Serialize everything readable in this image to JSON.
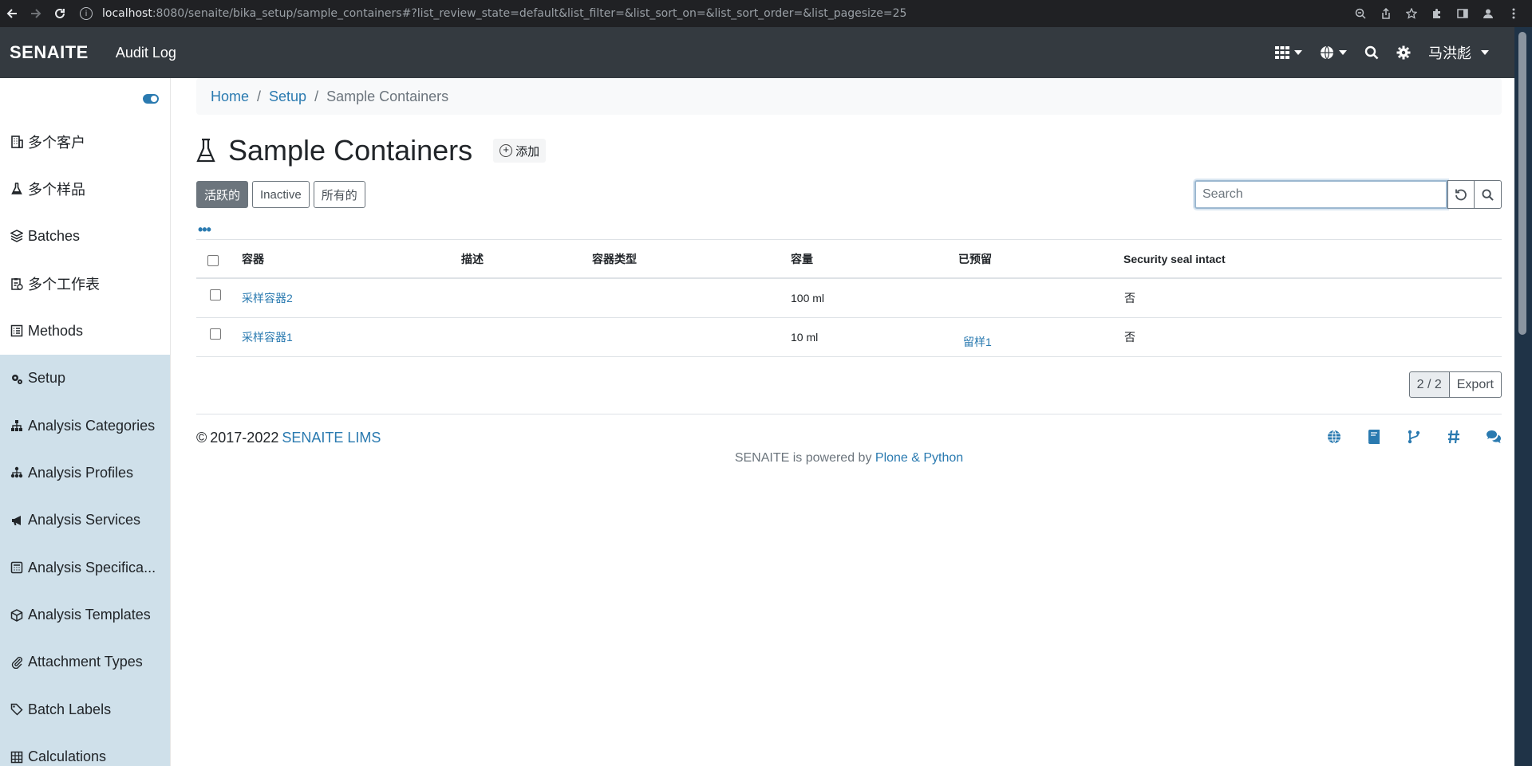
{
  "browser": {
    "url_host": "localhost",
    "url_rest": ":8080/senaite/bika_setup/sample_containers#?list_review_state=default&list_filter=&list_sort_on=&list_sort_order=&list_pagesize=25"
  },
  "navbar": {
    "brand": "SENAITE",
    "audit_log": "Audit Log",
    "user": "马洪彪"
  },
  "sidebar": {
    "items": [
      {
        "label": "多个客户",
        "icon": "clients-icon"
      },
      {
        "label": "多个样品",
        "icon": "flask-icon"
      },
      {
        "label": "Batches",
        "icon": "layers-icon"
      },
      {
        "label": "多个工作表",
        "icon": "worksheet-icon"
      },
      {
        "label": "Methods",
        "icon": "methods-icon"
      },
      {
        "label": "Setup",
        "icon": "gears-icon"
      },
      {
        "label": "Analysis Categories",
        "icon": "sitemap-icon"
      },
      {
        "label": "Analysis Profiles",
        "icon": "profiles-icon"
      },
      {
        "label": "Analysis Services",
        "icon": "bullhorn-icon"
      },
      {
        "label": "Analysis Specifica...",
        "icon": "calculator-icon"
      },
      {
        "label": "Analysis Templates",
        "icon": "box-icon"
      },
      {
        "label": "Attachment Types",
        "icon": "paperclip-icon"
      },
      {
        "label": "Batch Labels",
        "icon": "tags-icon"
      },
      {
        "label": "Calculations",
        "icon": "table-icon"
      }
    ]
  },
  "breadcrumb": {
    "home": "Home",
    "setup": "Setup",
    "current": "Sample Containers"
  },
  "page": {
    "title": "Sample Containers",
    "add_label": "添加"
  },
  "filters": {
    "active": "活跃的",
    "inactive": "Inactive",
    "all": "所有的"
  },
  "search": {
    "placeholder": "Search"
  },
  "more_dots": "•••",
  "table": {
    "headers": {
      "container": "容器",
      "description": "描述",
      "container_type": "容器类型",
      "capacity": "容量",
      "prereserved": "已预留",
      "security_seal": "Security seal intact"
    },
    "rows": [
      {
        "container": "采样容器2",
        "description": "",
        "container_type": "",
        "capacity": "100 ml",
        "prereserved": "",
        "security_seal": "否"
      },
      {
        "container": "采样容器1",
        "description": "",
        "container_type": "",
        "capacity": "10 ml",
        "prereserved": "留样1",
        "security_seal": "否"
      }
    ]
  },
  "pager": {
    "count": "2 / 2",
    "export": "Export"
  },
  "footer": {
    "copyright_symbol": "©",
    "years": "2017-2022",
    "lims_link": "SENAITE LIMS",
    "powered_by": "SENAITE is powered by",
    "plone_link": "Plone & Python"
  },
  "colors": {
    "navbar": "#343a40",
    "link": "#2a7ab0",
    "sidebar_active": "#cfe0ea"
  }
}
